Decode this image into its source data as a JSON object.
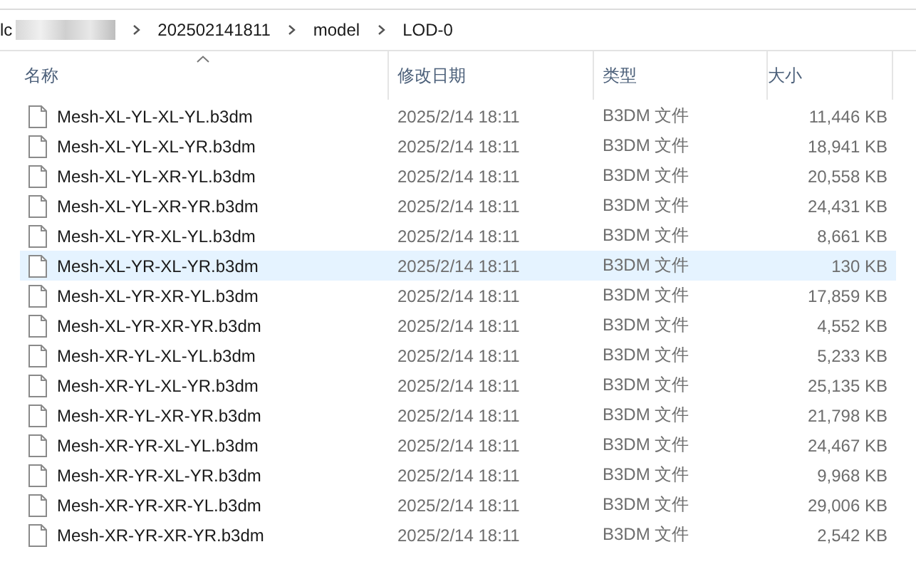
{
  "breadcrumb": {
    "segments": [
      "lc",
      "202502141811",
      "model",
      "LOD-0"
    ]
  },
  "columns": [
    {
      "label": "名称",
      "sorted": true
    },
    {
      "label": "修改日期",
      "sorted": false
    },
    {
      "label": "类型",
      "sorted": false
    },
    {
      "label": "大小",
      "sorted": false
    }
  ],
  "rows": [
    {
      "name": "Mesh-XL-YL-XL-YL.b3dm",
      "modified": "2025/2/14 18:11",
      "type": "B3DM 文件",
      "size": "11,446 KB",
      "selected": false
    },
    {
      "name": "Mesh-XL-YL-XL-YR.b3dm",
      "modified": "2025/2/14 18:11",
      "type": "B3DM 文件",
      "size": "18,941 KB",
      "selected": false
    },
    {
      "name": "Mesh-XL-YL-XR-YL.b3dm",
      "modified": "2025/2/14 18:11",
      "type": "B3DM 文件",
      "size": "20,558 KB",
      "selected": false
    },
    {
      "name": "Mesh-XL-YL-XR-YR.b3dm",
      "modified": "2025/2/14 18:11",
      "type": "B3DM 文件",
      "size": "24,431 KB",
      "selected": false
    },
    {
      "name": "Mesh-XL-YR-XL-YL.b3dm",
      "modified": "2025/2/14 18:11",
      "type": "B3DM 文件",
      "size": "8,661 KB",
      "selected": false
    },
    {
      "name": "Mesh-XL-YR-XL-YR.b3dm",
      "modified": "2025/2/14 18:11",
      "type": "B3DM 文件",
      "size": "130 KB",
      "selected": true
    },
    {
      "name": "Mesh-XL-YR-XR-YL.b3dm",
      "modified": "2025/2/14 18:11",
      "type": "B3DM 文件",
      "size": "17,859 KB",
      "selected": false
    },
    {
      "name": "Mesh-XL-YR-XR-YR.b3dm",
      "modified": "2025/2/14 18:11",
      "type": "B3DM 文件",
      "size": "4,552 KB",
      "selected": false
    },
    {
      "name": "Mesh-XR-YL-XL-YL.b3dm",
      "modified": "2025/2/14 18:11",
      "type": "B3DM 文件",
      "size": "5,233 KB",
      "selected": false
    },
    {
      "name": "Mesh-XR-YL-XL-YR.b3dm",
      "modified": "2025/2/14 18:11",
      "type": "B3DM 文件",
      "size": "25,135 KB",
      "selected": false
    },
    {
      "name": "Mesh-XR-YL-XR-YR.b3dm",
      "modified": "2025/2/14 18:11",
      "type": "B3DM 文件",
      "size": "21,798 KB",
      "selected": false
    },
    {
      "name": "Mesh-XR-YR-XL-YL.b3dm",
      "modified": "2025/2/14 18:11",
      "type": "B3DM 文件",
      "size": "24,467 KB",
      "selected": false
    },
    {
      "name": "Mesh-XR-YR-XL-YR.b3dm",
      "modified": "2025/2/14 18:11",
      "type": "B3DM 文件",
      "size": "9,968 KB",
      "selected": false
    },
    {
      "name": "Mesh-XR-YR-XR-YL.b3dm",
      "modified": "2025/2/14 18:11",
      "type": "B3DM 文件",
      "size": "29,006 KB",
      "selected": false
    },
    {
      "name": "Mesh-XR-YR-XR-YR.b3dm",
      "modified": "2025/2/14 18:11",
      "type": "B3DM 文件",
      "size": "2,542 KB",
      "selected": false
    }
  ]
}
